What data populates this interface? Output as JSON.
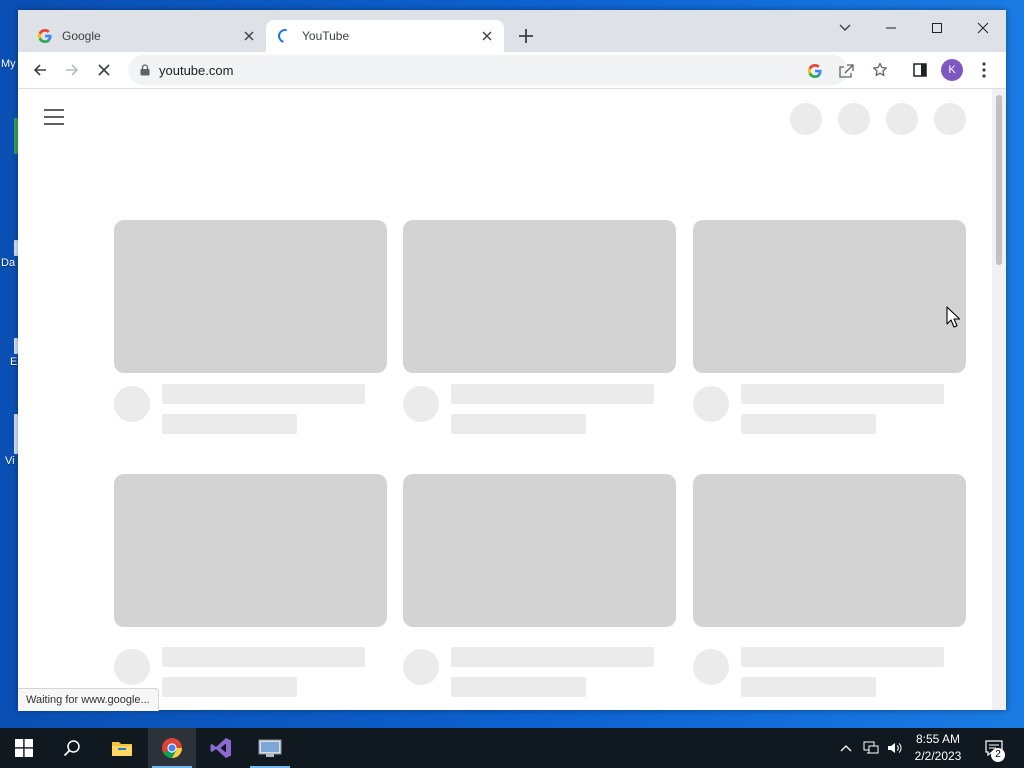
{
  "desktop": {
    "fragments": [
      "My",
      "Da",
      "E",
      "Vi"
    ]
  },
  "browser": {
    "tabs": [
      {
        "title": "Google",
        "favicon": "google-g-icon"
      },
      {
        "title": "YouTube",
        "favicon": "loading-spinner-icon",
        "active": true
      }
    ],
    "address": "youtube.com",
    "profile_initial": "K",
    "status_text": "Waiting for www.google..."
  },
  "taskbar": {
    "apps": [
      "start-icon",
      "search-icon",
      "file-explorer-icon",
      "chrome-icon",
      "visual-studio-icon",
      "remote-desktop-icon"
    ],
    "time": "8:55 AM",
    "date": "2/2/2023",
    "notification_count": "2"
  },
  "colors": {
    "accent": "#1a73e8",
    "profile": "#7e57c2",
    "skeleton_thumb": "#d3d3d3",
    "skeleton_light": "#ebebeb"
  }
}
